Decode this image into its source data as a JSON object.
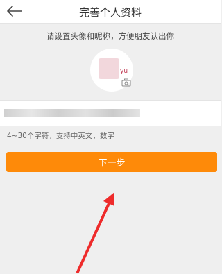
{
  "header": {
    "title": "完善个人资料",
    "back_icon": "arrow-left-icon"
  },
  "avatar_section": {
    "hint": "请设置头像和昵称，方便朋友认出你",
    "avatar_text": "yu",
    "camera_icon": "camera-icon"
  },
  "nickname": {
    "value": "",
    "hint": "4~30个字符，支持中英文，数字"
  },
  "next_button": {
    "label": "下一步",
    "color": "#fe8a09"
  },
  "annotation": {
    "color": "#ee2b2b"
  }
}
